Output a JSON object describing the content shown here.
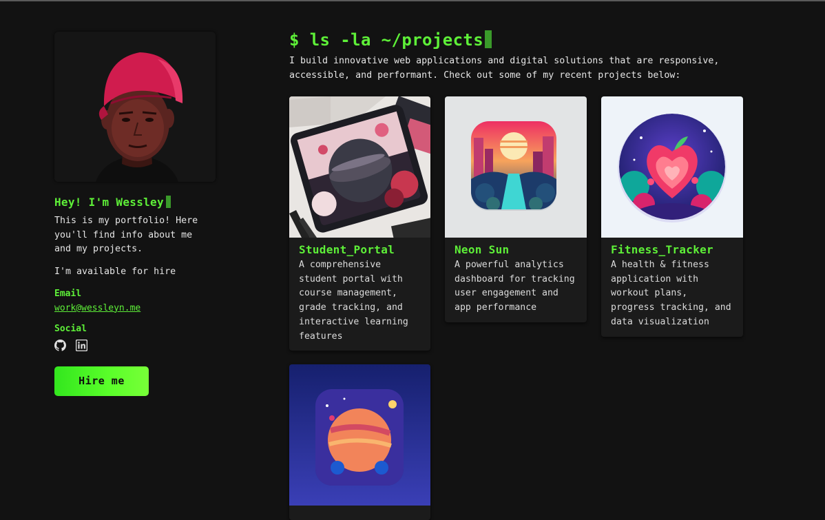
{
  "sidebar": {
    "greeting": "Hey! I'm Wessley",
    "intro": "This is my portfolio! Here you'll find info about me and my projects.",
    "availability": "I'm available for hire",
    "email_label": "Email",
    "email": "work@wessleyn.me",
    "social_label": "Social",
    "socials": [
      "github-icon",
      "linkedin-icon"
    ],
    "hire_button": "Hire me"
  },
  "main": {
    "headline": "$ ls -la ~/projects",
    "lead": "I build innovative web applications and digital solutions that are responsive, accessible, and performant. Check out some of my recent projects below:",
    "projects": [
      {
        "title": "Student_Portal",
        "description": "A comprehensive student portal with course management, grade tracking, and interactive learning features"
      },
      {
        "title": "Neon Sun",
        "description": "A powerful analytics dashboard for tracking user engagement and app performance"
      },
      {
        "title": "Fitness_Tracker",
        "description": "A health & fitness application with workout plans, progress tracking, and data visualization"
      },
      {
        "title": "",
        "description": ""
      }
    ]
  },
  "colors": {
    "accent": "#5ef038",
    "background": "#121212",
    "card": "#1b1b1b",
    "text": "#e6e6e6"
  }
}
